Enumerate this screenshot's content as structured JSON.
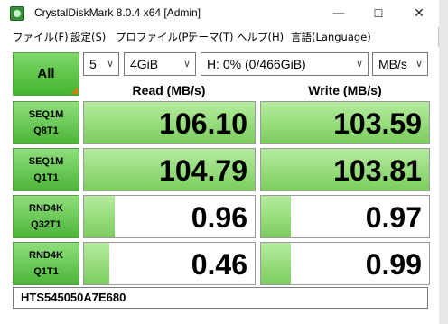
{
  "titlebar": {
    "title": "CrystalDiskMark 8.0.4 x64 [Admin]",
    "minimize": "—",
    "maximize": "☐",
    "close": "✕"
  },
  "menu": [
    "ファイル(F)",
    "設定(S)",
    "プロファイル(P)",
    "テーマ(T)",
    "ヘルプ(H)",
    "言語(Language)"
  ],
  "controls": {
    "all_label": "All",
    "count": "5",
    "size": "4GiB",
    "drive": "H: 0% (0/466GiB)",
    "unit": "MB/s",
    "dropdown_arrow": "∨"
  },
  "headers": {
    "read": "Read (MB/s)",
    "write": "Write (MB/s)"
  },
  "rows": [
    {
      "line1": "SEQ1M",
      "line2": "Q8T1",
      "read": "106.10",
      "write": "103.59",
      "read_fill": 1.0,
      "write_fill": 1.0
    },
    {
      "line1": "SEQ1M",
      "line2": "Q1T1",
      "read": "104.79",
      "write": "103.81",
      "read_fill": 1.0,
      "write_fill": 1.0
    },
    {
      "line1": "RND4K",
      "line2": "Q32T1",
      "read": "0.96",
      "write": "0.97",
      "read_fill": 0.18,
      "write_fill": 0.18
    },
    {
      "line1": "RND4K",
      "line2": "Q1T1",
      "read": "0.46",
      "write": "0.99",
      "read_fill": 0.15,
      "write_fill": 0.18
    }
  ],
  "comment": "HTS545050A7E680",
  "colors": {
    "accent_green": "#4db53a",
    "bar_green": "#7ccd5e"
  }
}
